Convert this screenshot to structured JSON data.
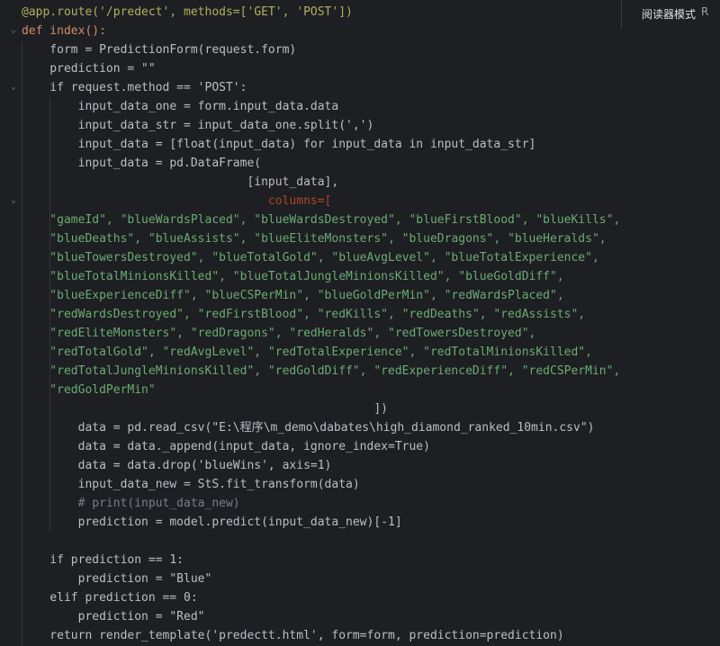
{
  "editor": {
    "reader_mode_label": "阅读器模式",
    "reader_overflow_label": "R",
    "fold_marker": "⌄",
    "lines": [
      [
        "@app.route('/predect', methods=['GET', 'POST'])"
      ],
      [
        "def index():"
      ],
      [
        "    form = PredictionForm(request.form)"
      ],
      [
        "    prediction = \"\""
      ],
      [
        "    if request.method == 'POST':"
      ],
      [
        "        input_data_one = form.input_data.data"
      ],
      [
        "        input_data_str = input_data_one.split(',')"
      ],
      [
        "        input_data = [float(input_data) for input_data in input_data_str]"
      ],
      [
        "        input_data = pd.DataFrame("
      ],
      [
        "                                [input_data],"
      ],
      [
        "                                   columns=["
      ],
      [
        "    \"gameId\", \"blueWardsPlaced\", \"blueWardsDestroyed\", \"blueFirstBlood\", \"blueKills\","
      ],
      [
        "    \"blueDeaths\", \"blueAssists\", \"blueEliteMonsters\", \"blueDragons\", \"blueHeralds\","
      ],
      [
        "    \"blueTowersDestroyed\", \"blueTotalGold\", \"blueAvgLevel\", \"blueTotalExperience\","
      ],
      [
        "    \"blueTotalMinionsKilled\", \"blueTotalJungleMinionsKilled\", \"blueGoldDiff\","
      ],
      [
        "    \"blueExperienceDiff\", \"blueCSPerMin\", \"blueGoldPerMin\", \"redWardsPlaced\","
      ],
      [
        "    \"redWardsDestroyed\", \"redFirstBlood\", \"redKills\", \"redDeaths\", \"redAssists\","
      ],
      [
        "    \"redEliteMonsters\", \"redDragons\", \"redHeralds\", \"redTowersDestroyed\","
      ],
      [
        "    \"redTotalGold\", \"redAvgLevel\", \"redTotalExperience\", \"redTotalMinionsKilled\","
      ],
      [
        "    \"redTotalJungleMinionsKilled\", \"redGoldDiff\", \"redExperienceDiff\", \"redCSPerMin\","
      ],
      [
        "    \"redGoldPerMin\""
      ],
      [
        "                                                  ])"
      ],
      [
        "        data = pd.read_csv(\"E:\\程序\\m_demo\\dabates\\high_diamond_ranked_10min.csv\")"
      ],
      [
        "        data = data._append(input_data, ignore_index=True)"
      ],
      [
        "        data = data.drop('blueWins', axis=1)"
      ],
      [
        "        input_data_new = StS.fit_transform(data)"
      ],
      [
        "        # print(input_data_new)"
      ],
      [
        "        prediction = model.predict(input_data_new)[-1]"
      ],
      [
        ""
      ],
      [
        "    if prediction == 1:"
      ],
      [
        "        prediction = \"Blue\""
      ],
      [
        "    elif prediction == 0:"
      ],
      [
        "        prediction = \"Red\""
      ],
      [
        "    return render_template('predectt.html', form=form, prediction=prediction)"
      ]
    ]
  }
}
